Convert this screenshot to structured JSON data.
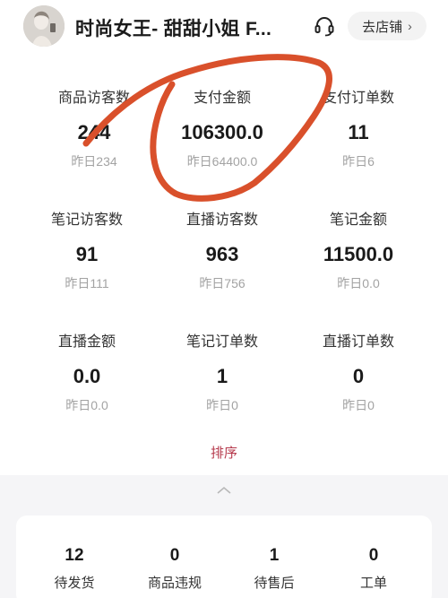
{
  "header": {
    "shop_name": "时尚女王- 甜甜小姐 F...",
    "go_store_label": "去店铺",
    "chevron": "›",
    "avatar_icon": "avatar-photo",
    "service_icon": "headset-icon"
  },
  "metrics": [
    {
      "label": "商品访客数",
      "value": "244",
      "yesterday": "昨日234"
    },
    {
      "label": "支付金额",
      "value": "106300.0",
      "yesterday": "昨日64400.0"
    },
    {
      "label": "支付订单数",
      "value": "11",
      "yesterday": "昨日6"
    },
    {
      "label": "笔记访客数",
      "value": "91",
      "yesterday": "昨日111"
    },
    {
      "label": "直播访客数",
      "value": "963",
      "yesterday": "昨日756"
    },
    {
      "label": "笔记金额",
      "value": "11500.0",
      "yesterday": "昨日0.0"
    },
    {
      "label": "直播金额",
      "value": "0.0",
      "yesterday": "昨日0.0"
    },
    {
      "label": "笔记订单数",
      "value": "1",
      "yesterday": "昨日0"
    },
    {
      "label": "直播订单数",
      "value": "0",
      "yesterday": "昨日0"
    }
  ],
  "sort_label": "排序",
  "orders": [
    {
      "count": "12",
      "label": "待发货"
    },
    {
      "count": "0",
      "label": "商品违规"
    },
    {
      "count": "1",
      "label": "待售后"
    },
    {
      "count": "0",
      "label": "工单"
    }
  ],
  "colors": {
    "accent": "#b5384b",
    "annotation": "#d9502b",
    "muted": "#a3a3a3"
  }
}
